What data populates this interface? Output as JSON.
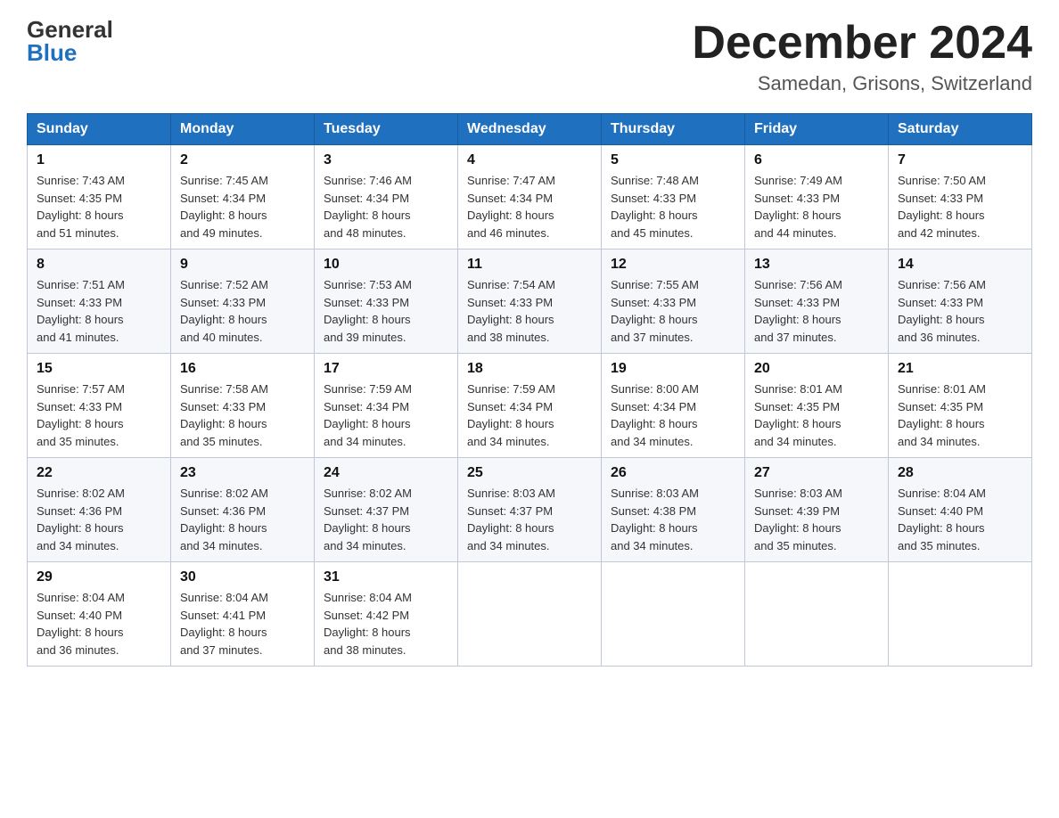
{
  "header": {
    "logo_general": "General",
    "logo_blue": "Blue",
    "month_title": "December 2024",
    "location": "Samedan, Grisons, Switzerland"
  },
  "weekdays": [
    "Sunday",
    "Monday",
    "Tuesday",
    "Wednesday",
    "Thursday",
    "Friday",
    "Saturday"
  ],
  "weeks": [
    [
      {
        "day": "1",
        "sunrise": "7:43 AM",
        "sunset": "4:35 PM",
        "daylight": "8 hours and 51 minutes."
      },
      {
        "day": "2",
        "sunrise": "7:45 AM",
        "sunset": "4:34 PM",
        "daylight": "8 hours and 49 minutes."
      },
      {
        "day": "3",
        "sunrise": "7:46 AM",
        "sunset": "4:34 PM",
        "daylight": "8 hours and 48 minutes."
      },
      {
        "day": "4",
        "sunrise": "7:47 AM",
        "sunset": "4:34 PM",
        "daylight": "8 hours and 46 minutes."
      },
      {
        "day": "5",
        "sunrise": "7:48 AM",
        "sunset": "4:33 PM",
        "daylight": "8 hours and 45 minutes."
      },
      {
        "day": "6",
        "sunrise": "7:49 AM",
        "sunset": "4:33 PM",
        "daylight": "8 hours and 44 minutes."
      },
      {
        "day": "7",
        "sunrise": "7:50 AM",
        "sunset": "4:33 PM",
        "daylight": "8 hours and 42 minutes."
      }
    ],
    [
      {
        "day": "8",
        "sunrise": "7:51 AM",
        "sunset": "4:33 PM",
        "daylight": "8 hours and 41 minutes."
      },
      {
        "day": "9",
        "sunrise": "7:52 AM",
        "sunset": "4:33 PM",
        "daylight": "8 hours and 40 minutes."
      },
      {
        "day": "10",
        "sunrise": "7:53 AM",
        "sunset": "4:33 PM",
        "daylight": "8 hours and 39 minutes."
      },
      {
        "day": "11",
        "sunrise": "7:54 AM",
        "sunset": "4:33 PM",
        "daylight": "8 hours and 38 minutes."
      },
      {
        "day": "12",
        "sunrise": "7:55 AM",
        "sunset": "4:33 PM",
        "daylight": "8 hours and 37 minutes."
      },
      {
        "day": "13",
        "sunrise": "7:56 AM",
        "sunset": "4:33 PM",
        "daylight": "8 hours and 37 minutes."
      },
      {
        "day": "14",
        "sunrise": "7:56 AM",
        "sunset": "4:33 PM",
        "daylight": "8 hours and 36 minutes."
      }
    ],
    [
      {
        "day": "15",
        "sunrise": "7:57 AM",
        "sunset": "4:33 PM",
        "daylight": "8 hours and 35 minutes."
      },
      {
        "day": "16",
        "sunrise": "7:58 AM",
        "sunset": "4:33 PM",
        "daylight": "8 hours and 35 minutes."
      },
      {
        "day": "17",
        "sunrise": "7:59 AM",
        "sunset": "4:34 PM",
        "daylight": "8 hours and 34 minutes."
      },
      {
        "day": "18",
        "sunrise": "7:59 AM",
        "sunset": "4:34 PM",
        "daylight": "8 hours and 34 minutes."
      },
      {
        "day": "19",
        "sunrise": "8:00 AM",
        "sunset": "4:34 PM",
        "daylight": "8 hours and 34 minutes."
      },
      {
        "day": "20",
        "sunrise": "8:01 AM",
        "sunset": "4:35 PM",
        "daylight": "8 hours and 34 minutes."
      },
      {
        "day": "21",
        "sunrise": "8:01 AM",
        "sunset": "4:35 PM",
        "daylight": "8 hours and 34 minutes."
      }
    ],
    [
      {
        "day": "22",
        "sunrise": "8:02 AM",
        "sunset": "4:36 PM",
        "daylight": "8 hours and 34 minutes."
      },
      {
        "day": "23",
        "sunrise": "8:02 AM",
        "sunset": "4:36 PM",
        "daylight": "8 hours and 34 minutes."
      },
      {
        "day": "24",
        "sunrise": "8:02 AM",
        "sunset": "4:37 PM",
        "daylight": "8 hours and 34 minutes."
      },
      {
        "day": "25",
        "sunrise": "8:03 AM",
        "sunset": "4:37 PM",
        "daylight": "8 hours and 34 minutes."
      },
      {
        "day": "26",
        "sunrise": "8:03 AM",
        "sunset": "4:38 PM",
        "daylight": "8 hours and 34 minutes."
      },
      {
        "day": "27",
        "sunrise": "8:03 AM",
        "sunset": "4:39 PM",
        "daylight": "8 hours and 35 minutes."
      },
      {
        "day": "28",
        "sunrise": "8:04 AM",
        "sunset": "4:40 PM",
        "daylight": "8 hours and 35 minutes."
      }
    ],
    [
      {
        "day": "29",
        "sunrise": "8:04 AM",
        "sunset": "4:40 PM",
        "daylight": "8 hours and 36 minutes."
      },
      {
        "day": "30",
        "sunrise": "8:04 AM",
        "sunset": "4:41 PM",
        "daylight": "8 hours and 37 minutes."
      },
      {
        "day": "31",
        "sunrise": "8:04 AM",
        "sunset": "4:42 PM",
        "daylight": "8 hours and 38 minutes."
      },
      null,
      null,
      null,
      null
    ]
  ],
  "labels": {
    "sunrise": "Sunrise:",
    "sunset": "Sunset:",
    "daylight": "Daylight:"
  }
}
